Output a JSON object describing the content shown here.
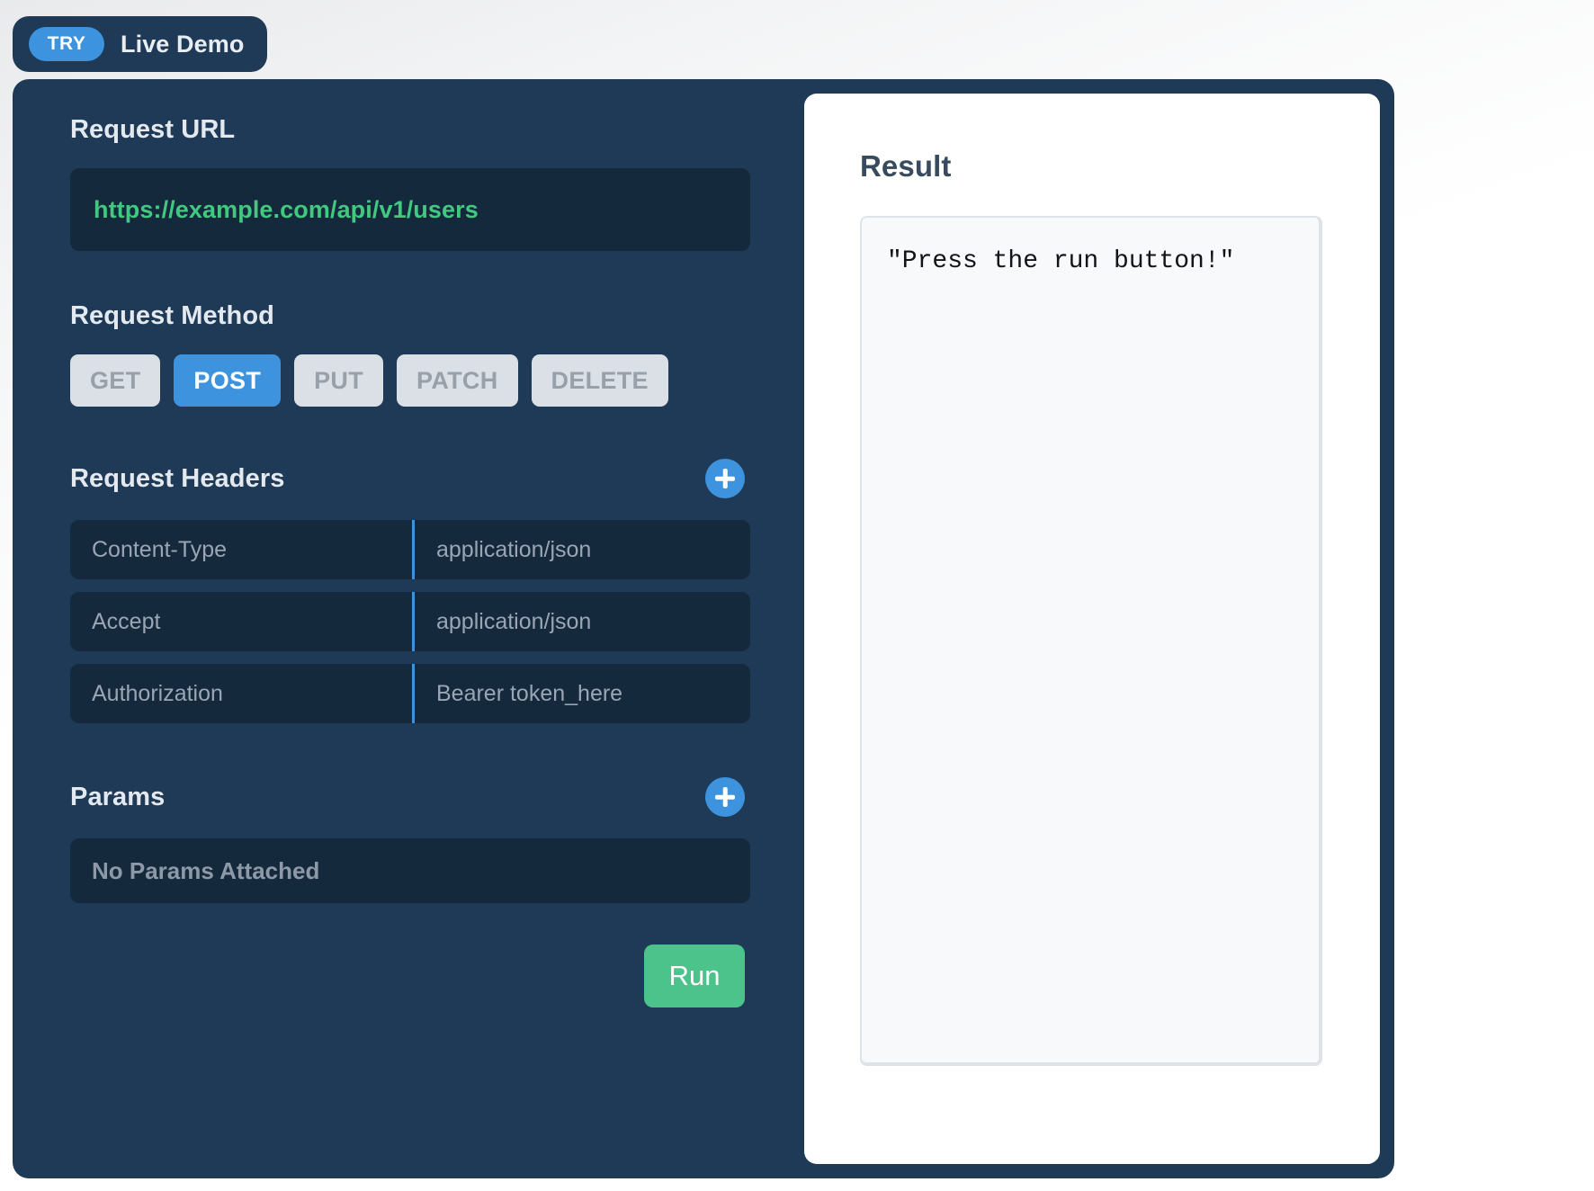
{
  "tab": {
    "badge": "TRY",
    "title": "Live Demo"
  },
  "request": {
    "url_label": "Request URL",
    "url_value": "https://example.com/api/v1/users",
    "method_label": "Request Method",
    "methods": [
      {
        "label": "GET",
        "active": false
      },
      {
        "label": "POST",
        "active": true
      },
      {
        "label": "PUT",
        "active": false
      },
      {
        "label": "PATCH",
        "active": false
      },
      {
        "label": "DELETE",
        "active": false
      }
    ],
    "selected_method": "POST",
    "headers_label": "Request Headers",
    "headers": [
      {
        "key": "Content-Type",
        "value": "application/json"
      },
      {
        "key": "Accept",
        "value": "application/json"
      },
      {
        "key": "Authorization",
        "value": "Bearer token_here"
      }
    ],
    "params_label": "Params",
    "params_empty_text": "No Params Attached",
    "add_header_icon": "plus-icon",
    "add_param_icon": "plus-icon",
    "run_label": "Run"
  },
  "result": {
    "title": "Result",
    "body": "\"Press the run button!\""
  },
  "colors": {
    "panel_bg": "#1f3a56",
    "field_bg": "#15293d",
    "accent_blue": "#3d93dd",
    "url_green": "#40c97f",
    "run_green": "#4cc38a",
    "method_idle_bg": "#dbe0e6",
    "method_idle_text": "#98a0aa",
    "result_bg": "#f7f9fa",
    "result_border": "#dde3e8"
  }
}
